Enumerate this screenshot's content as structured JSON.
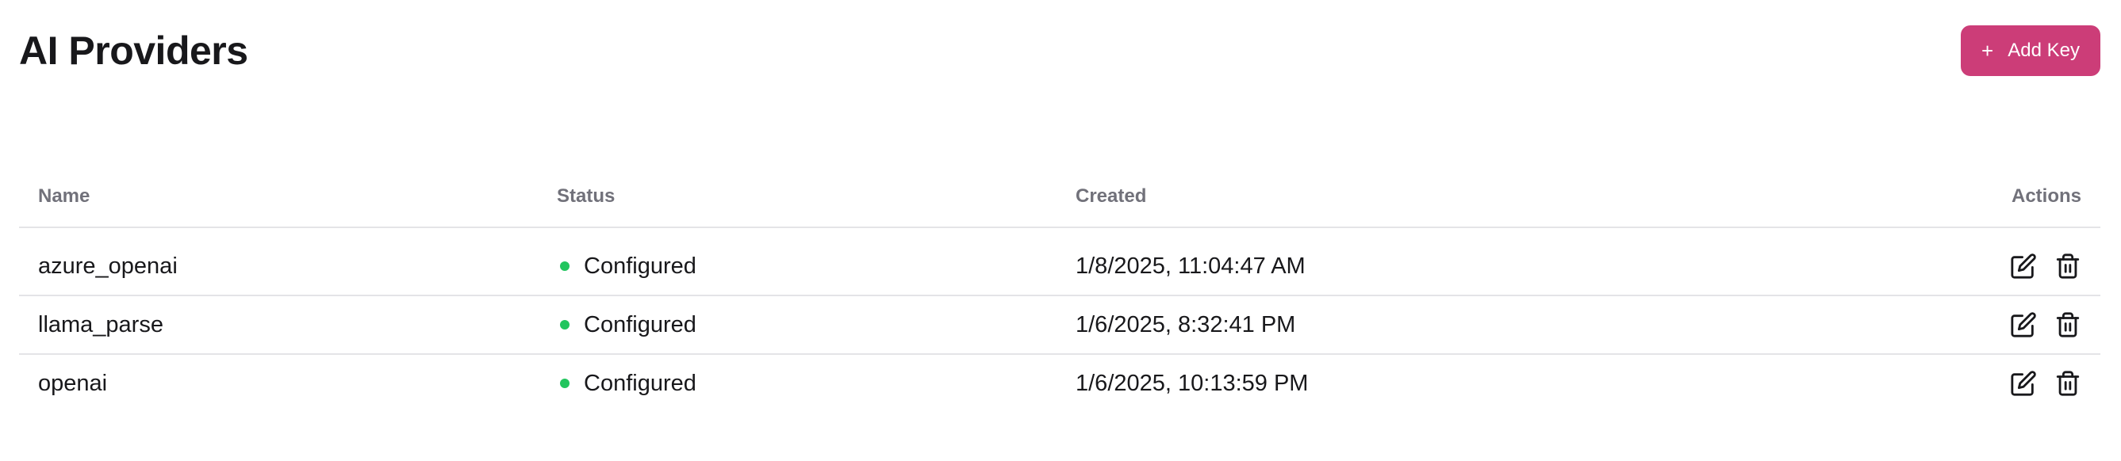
{
  "header": {
    "title": "AI Providers",
    "add_button_label": "Add Key",
    "add_button_icon": "plus-icon"
  },
  "colors": {
    "accent": "#cc3d78",
    "status_configured": "#22c55e",
    "border": "#e4e4e7",
    "header_text": "#71717a"
  },
  "table": {
    "columns": {
      "name": "Name",
      "status": "Status",
      "created": "Created",
      "actions": "Actions"
    },
    "rows": [
      {
        "name": "azure_openai",
        "status": "Configured",
        "created": "1/8/2025, 11:04:47 AM"
      },
      {
        "name": "llama_parse",
        "status": "Configured",
        "created": "1/6/2025, 8:32:41 PM"
      },
      {
        "name": "openai",
        "status": "Configured",
        "created": "1/6/2025, 10:13:59 PM"
      }
    ],
    "row_action_icons": [
      "edit-icon",
      "trash-icon"
    ]
  }
}
